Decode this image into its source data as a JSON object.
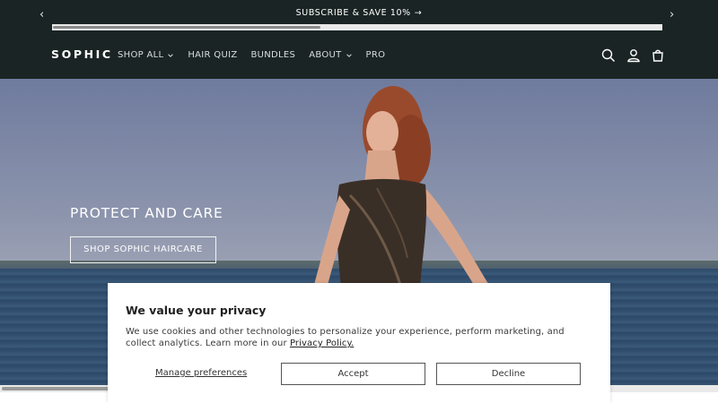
{
  "announcement": {
    "message": "SUBSCRIBE & SAVE 10%",
    "go_glyph": "→",
    "prev_glyph": "‹",
    "next_glyph": "›"
  },
  "header": {
    "logo": "SOPHIC",
    "nav": [
      {
        "label": "SHOP ALL",
        "has_dropdown": true
      },
      {
        "label": "HAIR QUIZ",
        "has_dropdown": false
      },
      {
        "label": "BUNDLES",
        "has_dropdown": false
      },
      {
        "label": "ABOUT",
        "has_dropdown": true
      },
      {
        "label": "PRO",
        "has_dropdown": false
      }
    ],
    "icons": [
      "search-icon",
      "account-icon",
      "cart-icon"
    ]
  },
  "hero": {
    "title": "PROTECT AND CARE",
    "button_label": "SHOP SOPHIC HAIRCARE"
  },
  "cookie": {
    "title": "We value your privacy",
    "body": "We use cookies and other technologies to personalize your experience, perform marketing, and collect analytics. Learn more in our ",
    "privacy_link": "Privacy Policy.",
    "manage_label": "Manage preferences",
    "accept_label": "Accept",
    "decline_label": "Decline"
  },
  "colors": {
    "header_bg": "#1a2424",
    "text_light": "#ffffff"
  }
}
